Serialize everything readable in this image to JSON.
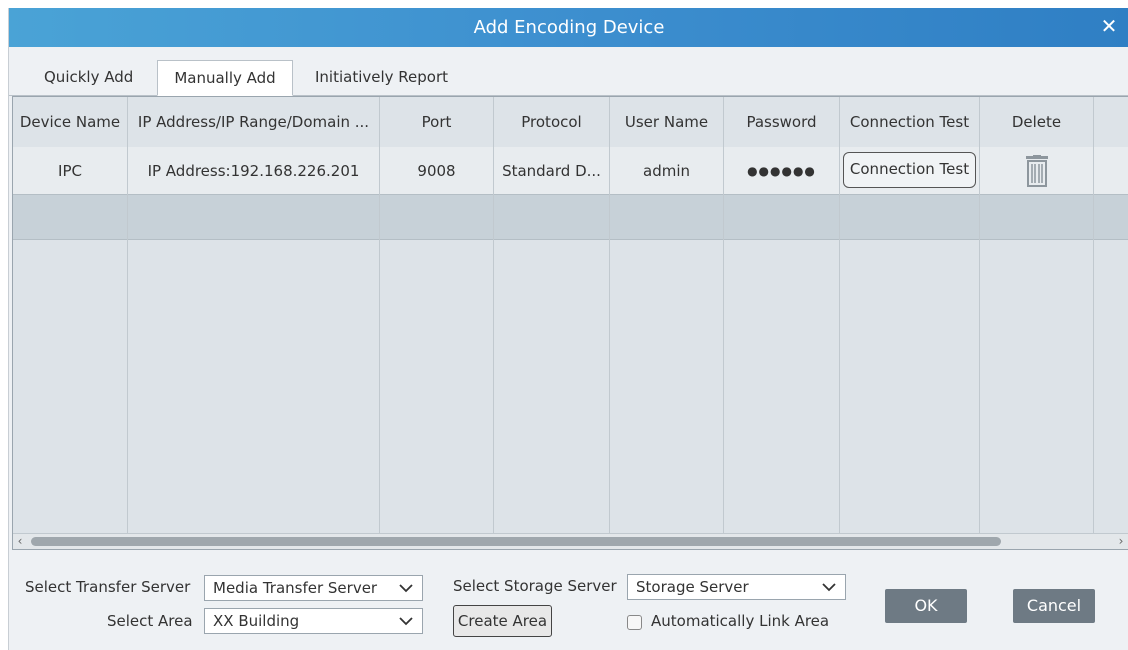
{
  "dialog": {
    "title": "Add Encoding Device"
  },
  "tabs": [
    {
      "label": "Quickly Add"
    },
    {
      "label": "Manually Add"
    },
    {
      "label": "Initiatively Report"
    }
  ],
  "table": {
    "headers": [
      "Device Name",
      "IP Address/IP Range/Domain ...",
      "Port",
      "Protocol",
      "User Name",
      "Password",
      "Connection Test",
      "Delete"
    ],
    "rows": [
      {
        "device_name": "IPC",
        "ip": "IP Address:192.168.226.201",
        "port": "9008",
        "protocol": "Standard D...",
        "user_name": "admin",
        "password": "●●●●●●",
        "connection_test": "Connection Test",
        "delete_icon": "trash-icon"
      }
    ]
  },
  "footer": {
    "transfer_label": "Select Transfer Server",
    "transfer_value": "Media Transfer Server",
    "area_label": "Select Area",
    "area_value": "XX Building",
    "storage_label": "Select Storage Server",
    "storage_value": "Storage Server",
    "create_area": "Create Area",
    "link_area": "Automatically Link Area",
    "ok": "OK",
    "cancel": "Cancel"
  },
  "colors": {
    "title_start": "#4aa3d6",
    "title_end": "#2f7fc4",
    "button": "#6e7a84"
  }
}
